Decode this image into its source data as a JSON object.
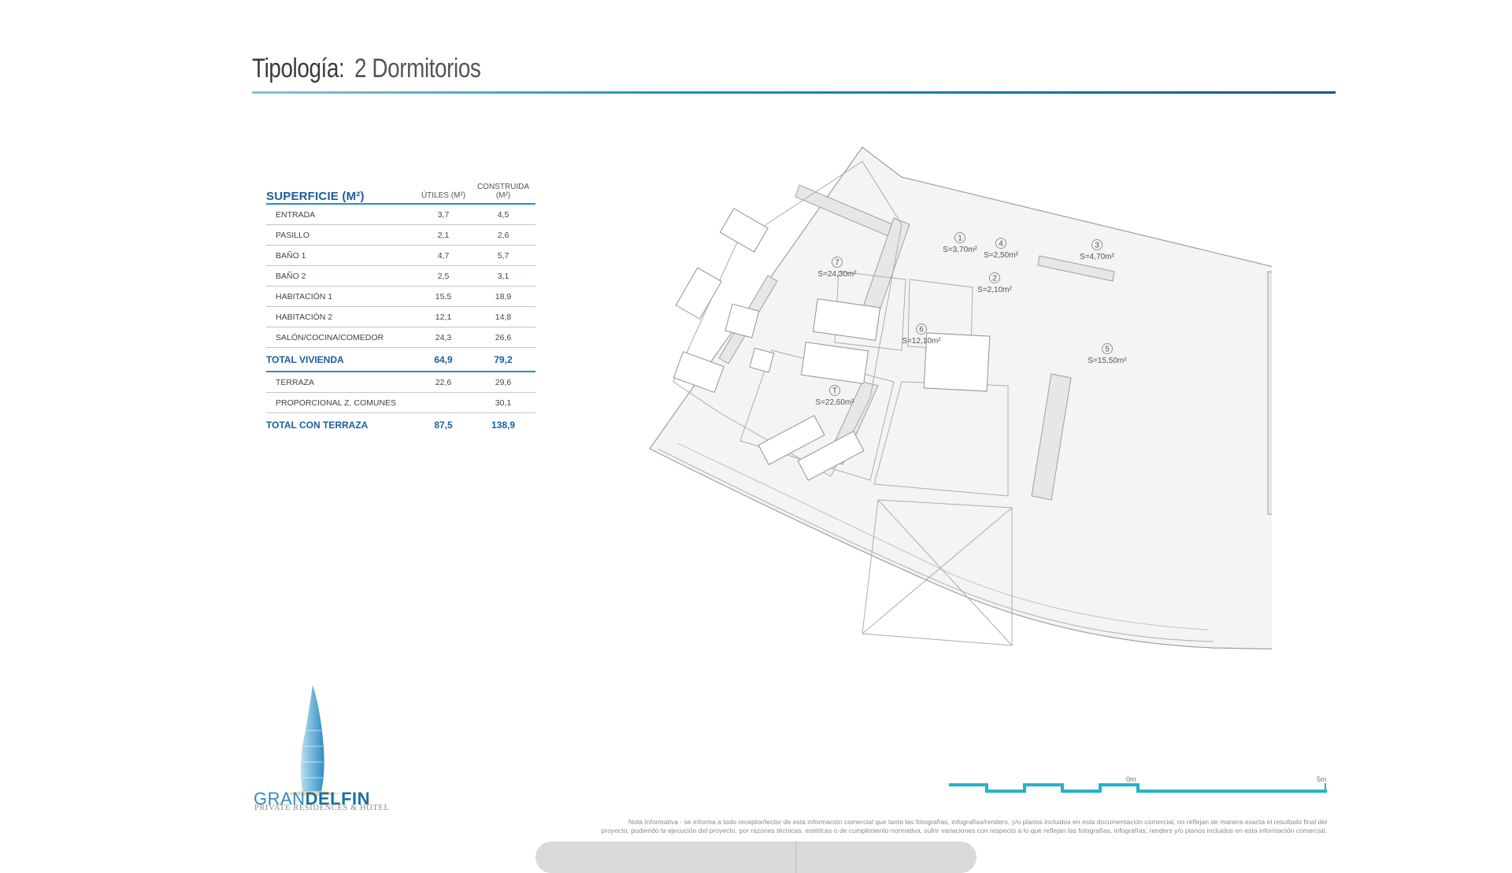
{
  "header": {
    "title_key": "Tipología:",
    "title_value": "2 Dormitorios"
  },
  "table": {
    "headers": [
      "SUPERFICIE (M²)",
      "ÚTILES (M²)",
      "CONSTRUIDA (M²)"
    ],
    "rows": [
      {
        "name": "ENTRADA",
        "utiles": "3,7",
        "construida": "4,5",
        "total": false
      },
      {
        "name": "PASILLO",
        "utiles": "2,1",
        "construida": "2,6",
        "total": false
      },
      {
        "name": "BAÑO 1",
        "utiles": "4,7",
        "construida": "5,7",
        "total": false
      },
      {
        "name": "BAÑO 2",
        "utiles": "2,5",
        "construida": "3,1",
        "total": false
      },
      {
        "name": "HABITACIÓN 1",
        "utiles": "15,5",
        "construida": "18,9",
        "total": false
      },
      {
        "name": "HABITACIÓN 2",
        "utiles": "12,1",
        "construida": "14,8",
        "total": false
      },
      {
        "name": "SALÓN/COCINA/COMEDOR",
        "utiles": "24,3",
        "construida": "26,6",
        "total": false
      },
      {
        "name": "TOTAL VIVIENDA",
        "utiles": "64,9",
        "construida": "79,2",
        "total": true
      },
      {
        "name": "TERRAZA",
        "utiles": "22,6",
        "construida": "29,6",
        "total": false
      },
      {
        "name": "PROPORCIONAL Z. COMUNES",
        "utiles": "",
        "construida": "30,1",
        "total": false
      },
      {
        "name": "TOTAL CON TERRAZA",
        "utiles": "87,5",
        "construida": "138,9",
        "total": true
      }
    ]
  },
  "plan": {
    "rooms": [
      {
        "num": "1",
        "area": "S=3,70m²"
      },
      {
        "num": "2",
        "area": "S=2,10m²"
      },
      {
        "num": "3",
        "area": "S=4,70m²"
      },
      {
        "num": "4",
        "area": "S=2,50m²"
      },
      {
        "num": "5",
        "area": "S=15,50m²"
      },
      {
        "num": "6",
        "area": "S=12,10m²"
      },
      {
        "num": "7",
        "area": "S=24,30m²"
      },
      {
        "num": "T",
        "area": "S=22,60m²"
      }
    ]
  },
  "logo": {
    "name_light": "GRAN",
    "name_bold": "DELFIN",
    "subtitle": "PRIVATE RESIDENCES & HOTEL"
  },
  "scale": {
    "label_start": "0m",
    "label_end": "5m"
  },
  "note": {
    "line1": "Nota Informativa - se informa a todo receptor/lector de esta información comercial que tanto las fotografías, infografías/renders, y/o planos incluidos en esta documentación comercial, no reflejan de manera exacta el resultado final del",
    "line2": "proyecto, pudiendo la ejecución del proyecto, por razones técnicas, estéticas o de cumplimiento normativa, sufrir variaciones con respecto a lo que reflejan las fotografías, infografías, renders y/o planos incluidos en esta información comercial."
  },
  "colors": {
    "accent": "#2e8cc4",
    "dark_blue": "#1b5e9e",
    "scale_teal": "#22b3c9"
  }
}
